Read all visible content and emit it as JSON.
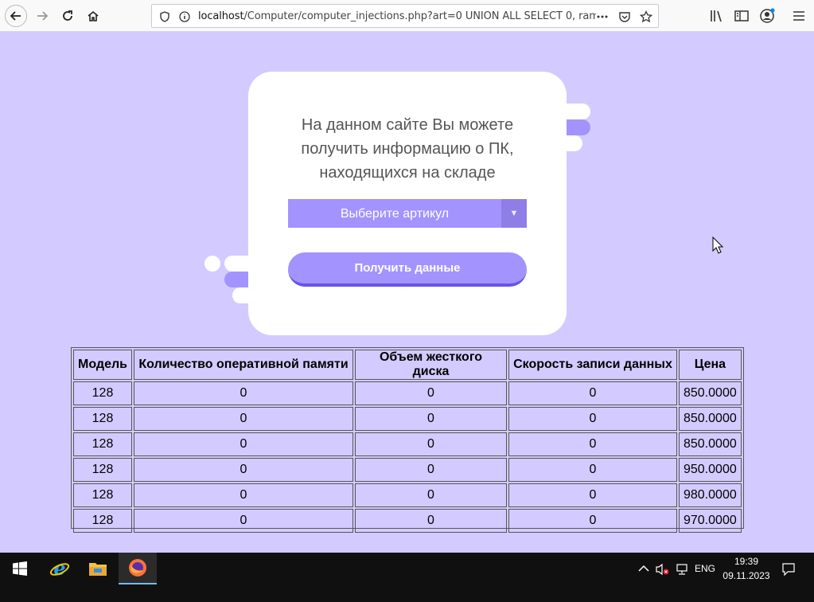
{
  "browser": {
    "url_host": "localhost",
    "url_rest": "/Computer/computer_injections.php?art=0 UNION ALL SELECT 0, ram,"
  },
  "card": {
    "line1": "На данном сайте Вы можете",
    "line2": "получить информацию о ПК,",
    "line3": "находящихся на складе",
    "select_placeholder": "Выберите артикул",
    "select_arrow": "▼",
    "submit_label": "Получить данные"
  },
  "table": {
    "headers": [
      "Модель",
      "Количество оперативной памяти",
      "Объем жесткого диска",
      "Скорость записи данных",
      "Цена"
    ],
    "rows": [
      [
        "128",
        "0",
        "0",
        "0",
        "850.0000"
      ],
      [
        "128",
        "0",
        "0",
        "0",
        "850.0000"
      ],
      [
        "128",
        "0",
        "0",
        "0",
        "850.0000"
      ],
      [
        "128",
        "0",
        "0",
        "0",
        "950.0000"
      ],
      [
        "128",
        "0",
        "0",
        "0",
        "980.0000"
      ],
      [
        "128",
        "0",
        "0",
        "0",
        "970.0000"
      ]
    ]
  },
  "taskbar": {
    "language": "ENG",
    "time": "19:39",
    "date": "09.11.2023"
  },
  "colors": {
    "page_bg": "#d3cbff",
    "accent": "#a393ff",
    "accent_dark": "#6a52e8"
  }
}
